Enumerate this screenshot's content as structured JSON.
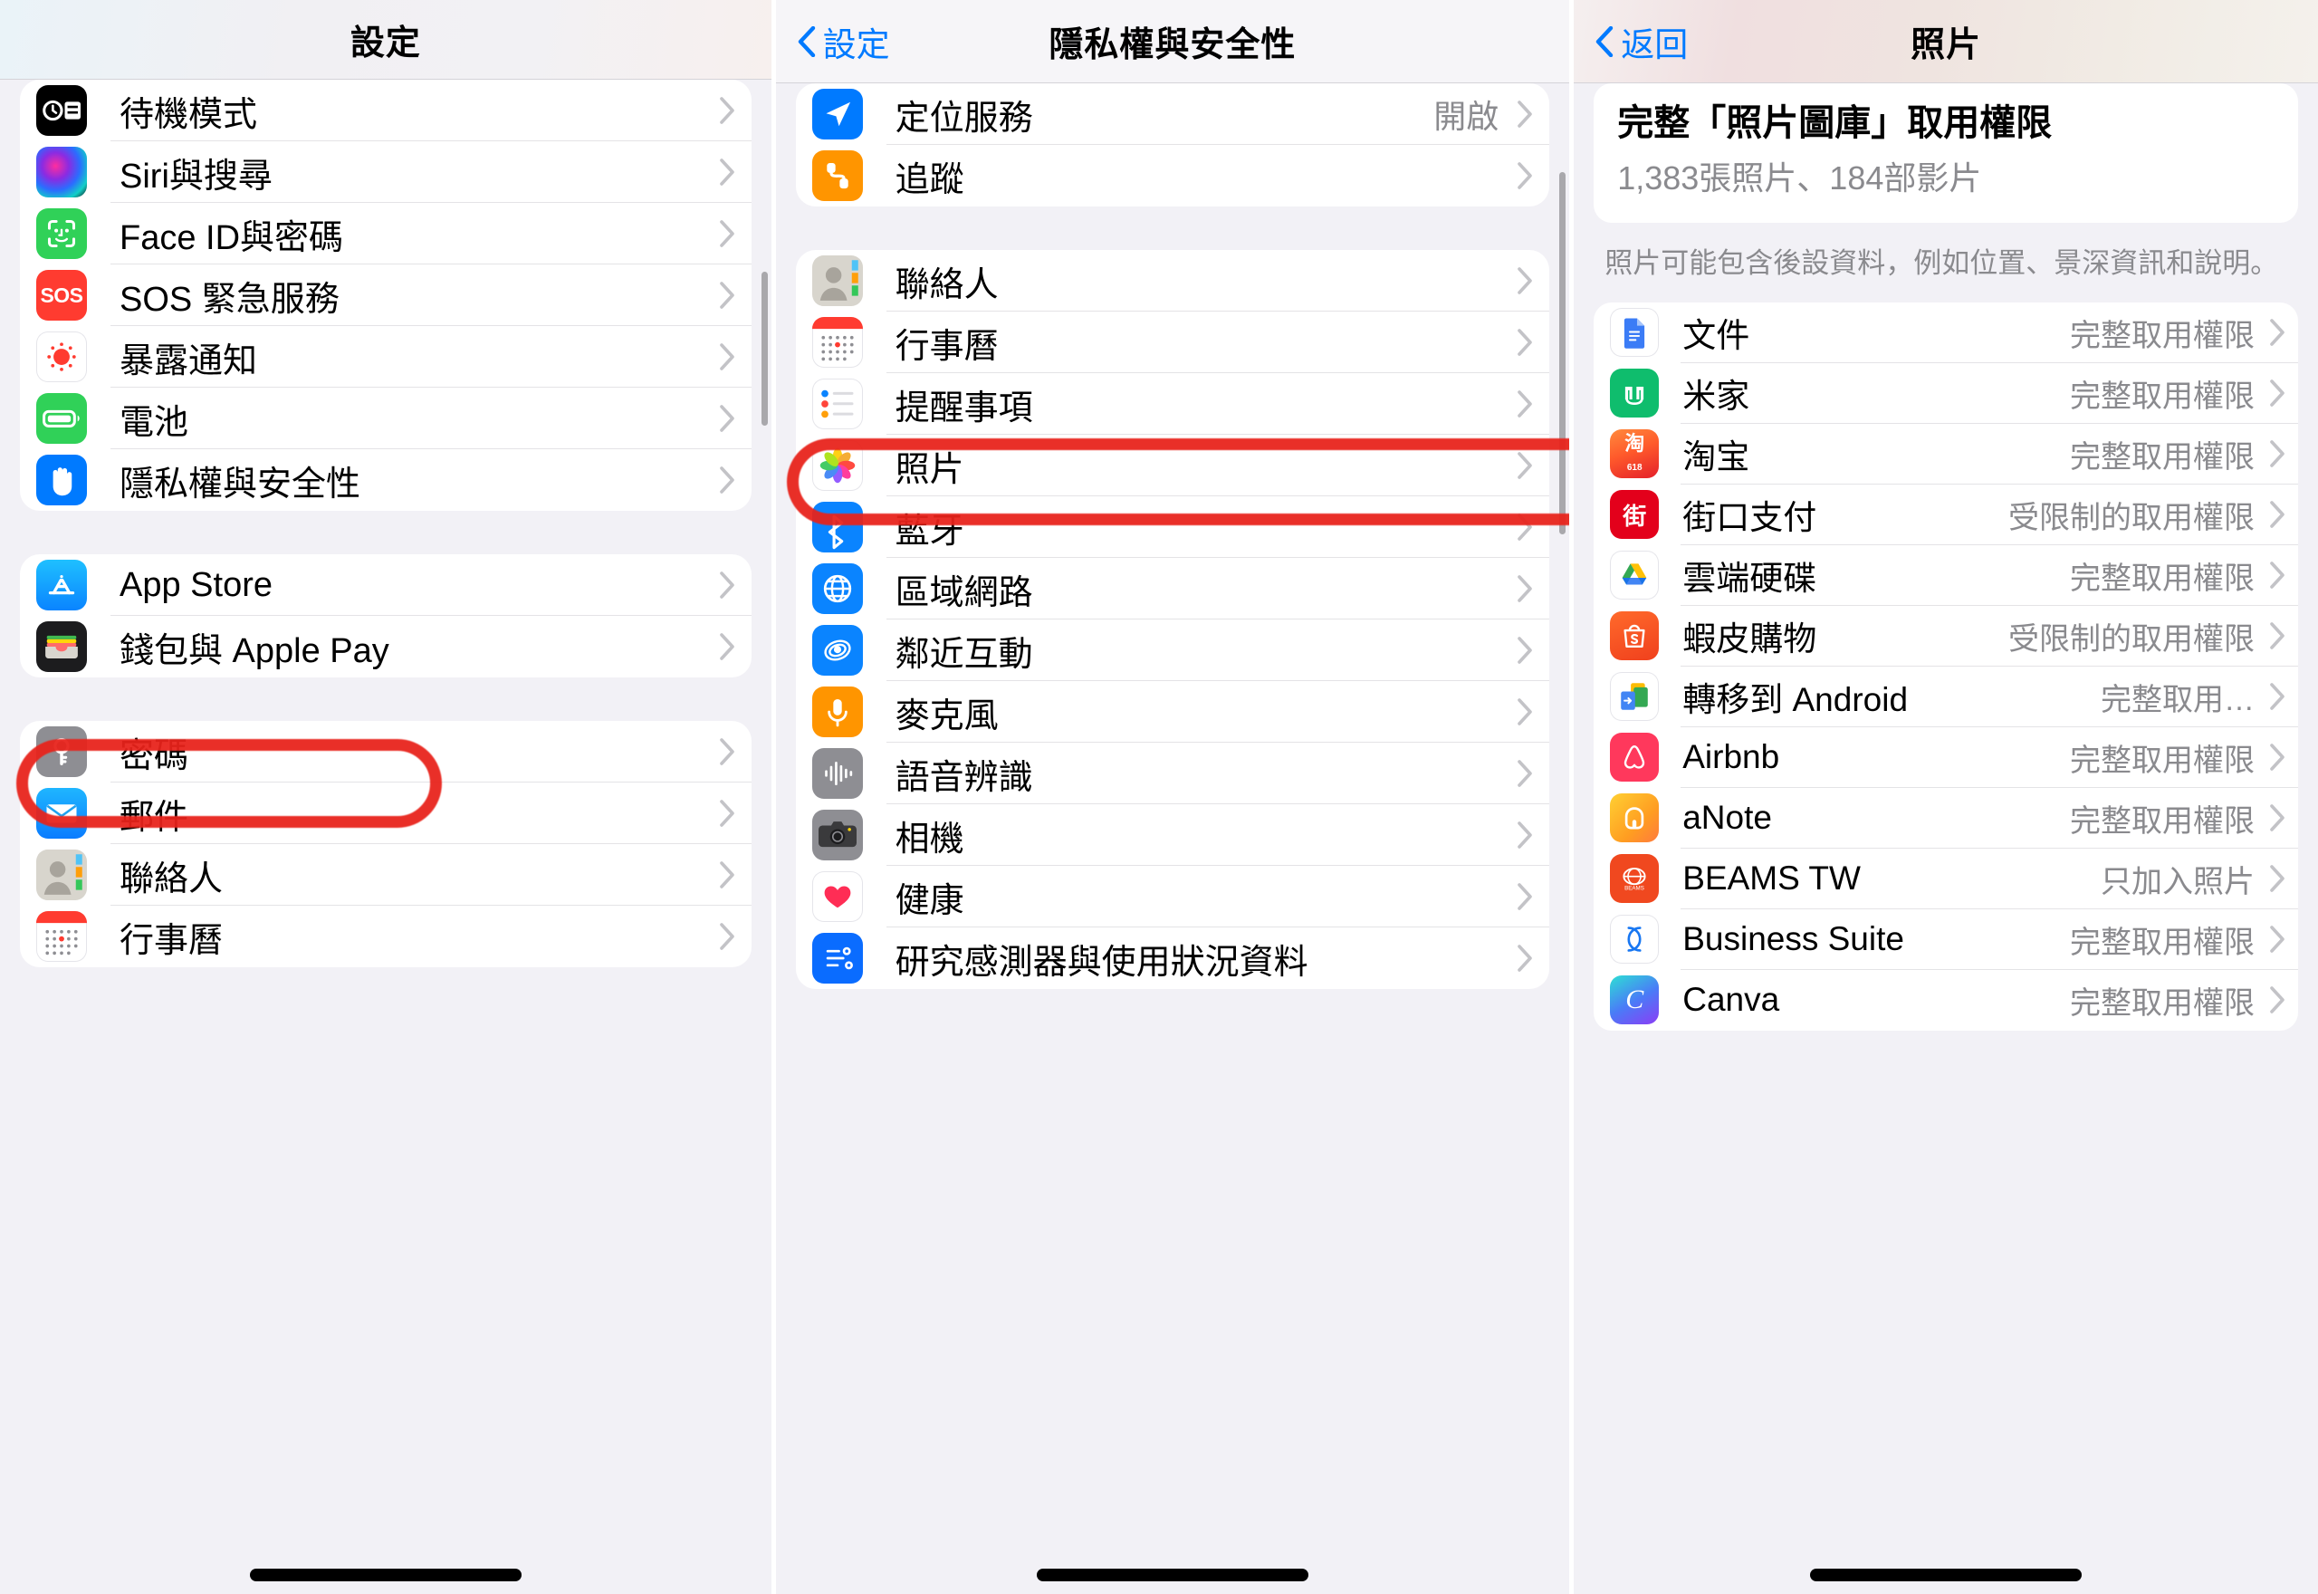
{
  "left_panel": {
    "nav": {
      "title": "設定"
    },
    "groups": [
      {
        "id": "group-main",
        "rows": [
          {
            "label": "待機模式",
            "icon": "standby-icon",
            "value": ""
          },
          {
            "label": "Siri與搜尋",
            "icon": "siri-icon",
            "value": ""
          },
          {
            "label": "Face ID與密碼",
            "icon": "faceid-icon",
            "value": ""
          },
          {
            "label": "SOS 緊急服務",
            "icon": "sos-icon",
            "value": ""
          },
          {
            "label": "暴露通知",
            "icon": "exposure-icon",
            "value": ""
          },
          {
            "label": "電池",
            "icon": "battery-icon",
            "value": ""
          },
          {
            "label": "隱私權與安全性",
            "icon": "privacy-hand-icon",
            "value": "",
            "highlighted": true
          }
        ]
      },
      {
        "id": "group-store",
        "rows": [
          {
            "label": "App Store",
            "icon": "appstore-icon",
            "value": ""
          },
          {
            "label": "錢包與 Apple Pay",
            "icon": "wallet-icon",
            "value": ""
          }
        ]
      },
      {
        "id": "group-apps",
        "rows": [
          {
            "label": "密碼",
            "icon": "passwords-key-icon",
            "value": ""
          },
          {
            "label": "郵件",
            "icon": "mail-icon",
            "value": ""
          },
          {
            "label": "聯絡人",
            "icon": "contacts-icon",
            "value": ""
          },
          {
            "label": "行事曆",
            "icon": "calendar-icon",
            "value": ""
          }
        ]
      }
    ]
  },
  "middle_panel": {
    "nav": {
      "back_label": "設定",
      "title": "隱私權與安全性"
    },
    "groups": [
      {
        "id": "group-location",
        "rows": [
          {
            "label": "定位服務",
            "icon": "location-arrow-icon",
            "value": "開啟"
          },
          {
            "label": "追蹤",
            "icon": "tracking-icon",
            "value": ""
          }
        ]
      },
      {
        "id": "group-permissions",
        "rows": [
          {
            "label": "聯絡人",
            "icon": "contacts-icon",
            "value": ""
          },
          {
            "label": "行事曆",
            "icon": "calendar-icon",
            "value": ""
          },
          {
            "label": "提醒事項",
            "icon": "reminders-icon",
            "value": ""
          },
          {
            "label": "照片",
            "icon": "photos-icon",
            "value": "",
            "highlighted": true
          },
          {
            "label": "藍牙",
            "icon": "bluetooth-icon",
            "value": ""
          },
          {
            "label": "區域網路",
            "icon": "localnetwork-icon",
            "value": ""
          },
          {
            "label": "鄰近互動",
            "icon": "nearby-icon",
            "value": ""
          },
          {
            "label": "麥克風",
            "icon": "microphone-icon",
            "value": ""
          },
          {
            "label": "語音辨識",
            "icon": "speech-icon",
            "value": ""
          },
          {
            "label": "相機",
            "icon": "camera-icon",
            "value": ""
          },
          {
            "label": "健康",
            "icon": "health-heart-icon",
            "value": ""
          },
          {
            "label": "研究感測器與使用狀況資料",
            "icon": "research-sensor-icon",
            "value": ""
          }
        ]
      }
    ]
  },
  "right_panel": {
    "nav": {
      "back_label": "返回",
      "title": "照片"
    },
    "header": {
      "title": "完整「照片圖庫」取用權限",
      "subtitle": "1,383張照片、184部影片"
    },
    "note": "照片可能包含後設資料，例如位置、景深資訊和說明。",
    "apps": [
      {
        "name": "文件",
        "icon": "google-docs-icon",
        "access": "完整取用權限"
      },
      {
        "name": "米家",
        "icon": "mijia-icon",
        "access": "完整取用權限"
      },
      {
        "name": "淘宝",
        "icon": "taobao-icon",
        "access": "完整取用權限"
      },
      {
        "name": "街口支付",
        "icon": "jkopay-icon",
        "access": "受限制的取用權限"
      },
      {
        "name": "雲端硬碟",
        "icon": "google-drive-icon",
        "access": "完整取用權限"
      },
      {
        "name": "蝦皮購物",
        "icon": "shopee-icon",
        "access": "受限制的取用權限"
      },
      {
        "name": "轉移到 Android",
        "icon": "move-to-android-icon",
        "access": "完整取用…"
      },
      {
        "name": "Airbnb",
        "icon": "airbnb-icon",
        "access": "完整取用權限"
      },
      {
        "name": "aNote",
        "icon": "anote-icon",
        "access": "完整取用權限"
      },
      {
        "name": "BEAMS TW",
        "icon": "beams-icon",
        "access": "只加入照片"
      },
      {
        "name": "Business Suite",
        "icon": "business-suite-icon",
        "access": "完整取用權限"
      },
      {
        "name": "Canva",
        "icon": "canva-icon",
        "access": "完整取用權限"
      }
    ]
  },
  "colors": {
    "accent_blue": "#007aff",
    "separator": "#e4e3e6",
    "page_bg": "#f2f1f6",
    "secondary_text": "#8a8a8e",
    "marker_red": "#e8231b"
  }
}
